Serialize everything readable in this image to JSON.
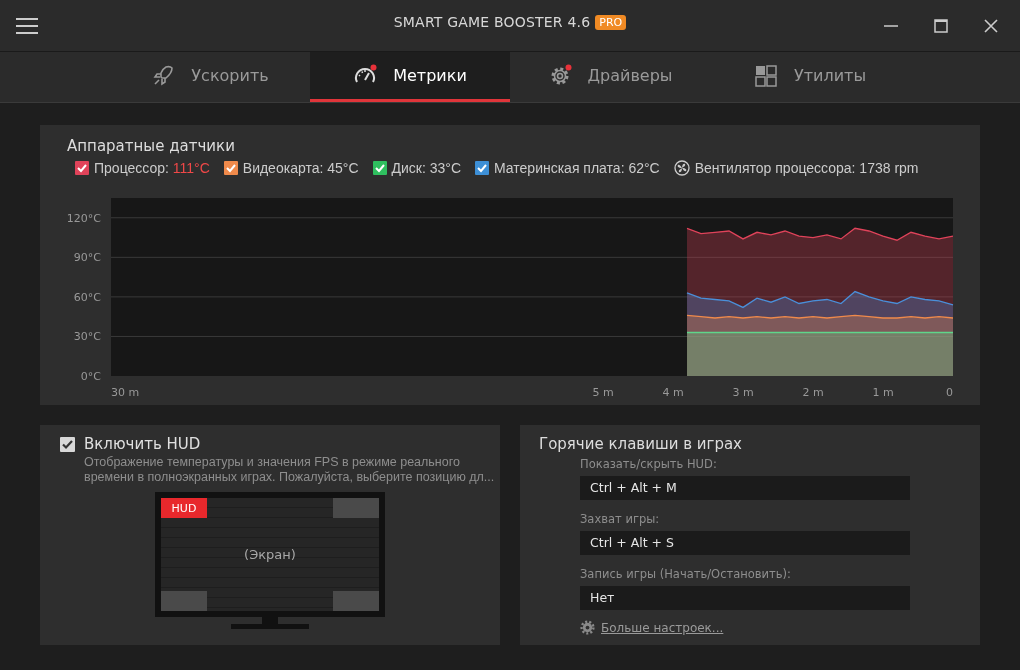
{
  "window": {
    "title": "SMART GAME BOOSTER 4.6",
    "edition_badge": "PRO"
  },
  "tabs": [
    {
      "label": "Ускорить",
      "selected": false,
      "dot": false
    },
    {
      "label": "Метрики",
      "selected": true,
      "dot": true
    },
    {
      "label": "Драйверы",
      "selected": false,
      "dot": true
    },
    {
      "label": "Утилиты",
      "selected": false,
      "dot": false
    }
  ],
  "sensors": {
    "title": "Аппаратные датчики",
    "axis_start_label": "30 m",
    "legend": [
      {
        "kind": "checkbox",
        "label": "Процессор:",
        "value": "111°C",
        "checked": true,
        "warning": true,
        "color": "#e0435a"
      },
      {
        "kind": "checkbox",
        "label": "Видеокарта:",
        "value": "45°C",
        "checked": true,
        "warning": false,
        "color": "#f08a4b"
      },
      {
        "kind": "checkbox",
        "label": "Диск:",
        "value": "33°C",
        "checked": true,
        "warning": false,
        "color": "#2fbf5f"
      },
      {
        "kind": "checkbox",
        "label": "Материнская плата:",
        "value": "62°C",
        "checked": true,
        "warning": false,
        "color": "#3d8fd6"
      },
      {
        "kind": "fan",
        "label": "Вентилятор процессора:",
        "value": "1738 rpm"
      }
    ],
    "chart_data": {
      "type": "area",
      "x": [
        -3.8,
        -3.6,
        -3.4,
        -3.2,
        -3.0,
        -2.8,
        -2.6,
        -2.4,
        -2.2,
        -2.0,
        -1.8,
        -1.6,
        -1.4,
        -1.2,
        -1.0,
        -0.8,
        -0.6,
        -0.4,
        -0.2,
        0
      ],
      "series": [
        {
          "color": "#e0435a",
          "values": [
            112,
            108,
            109,
            110,
            104,
            109,
            107,
            110,
            106,
            105,
            107,
            104,
            112,
            110,
            106,
            103,
            109,
            106,
            104,
            106
          ]
        },
        {
          "color": "#4a8fd9",
          "values": [
            63,
            59,
            58,
            57,
            52,
            59,
            56,
            60,
            55,
            57,
            58,
            55,
            64,
            60,
            57,
            55,
            60,
            58,
            57,
            54
          ]
        },
        {
          "color": "#f08a4b",
          "values": [
            46,
            45,
            44,
            45,
            44,
            45,
            44,
            45,
            44,
            45,
            44,
            45,
            46,
            45,
            44,
            44,
            45,
            44,
            45,
            44
          ]
        },
        {
          "color": "#5fd68a",
          "values": [
            33,
            33,
            33,
            33,
            33,
            33,
            33,
            33,
            33,
            33,
            33,
            33,
            33,
            33,
            33,
            33,
            33,
            33,
            33,
            33
          ]
        }
      ],
      "xlim": [
        -12.03,
        0
      ],
      "ylim": [
        0,
        135
      ],
      "grid": true,
      "xticks": [
        {
          "value": -5,
          "label": "5 m"
        },
        {
          "value": -4,
          "label": "4 m"
        },
        {
          "value": -3,
          "label": "3 m"
        },
        {
          "value": -2,
          "label": "2 m"
        },
        {
          "value": -1,
          "label": "1 m"
        },
        {
          "value": 0,
          "label": "0"
        }
      ],
      "yticks": [
        {
          "value": 0,
          "label": "0°C"
        },
        {
          "value": 30,
          "label": "30°C"
        },
        {
          "value": 60,
          "label": "60°C"
        },
        {
          "value": 90,
          "label": "90°C"
        },
        {
          "value": 120,
          "label": "120°C"
        }
      ]
    }
  },
  "hud": {
    "label": "Включить HUD",
    "checked": true,
    "description": "Отображение температуры и значения FPS в режиме реального времени в полноэкранных играх. Пожалуйста, выберите позицию дл...",
    "badge": "HUD",
    "screen_label": "(Экран)",
    "positions": [
      {
        "selected": true
      },
      {
        "selected": false
      },
      {
        "selected": false
      },
      {
        "selected": false
      }
    ]
  },
  "hotkeys": {
    "title": "Горячие клавиши в играх",
    "fields": [
      {
        "label": "Показать/скрыть HUD:",
        "value": "Ctrl + Alt + M"
      },
      {
        "label": "Захват игры:",
        "value": "Ctrl + Alt + S"
      },
      {
        "label": "Запись игры (Начать/Остановить):",
        "value": "Нет"
      }
    ],
    "more_link": "Больше настроек..."
  }
}
